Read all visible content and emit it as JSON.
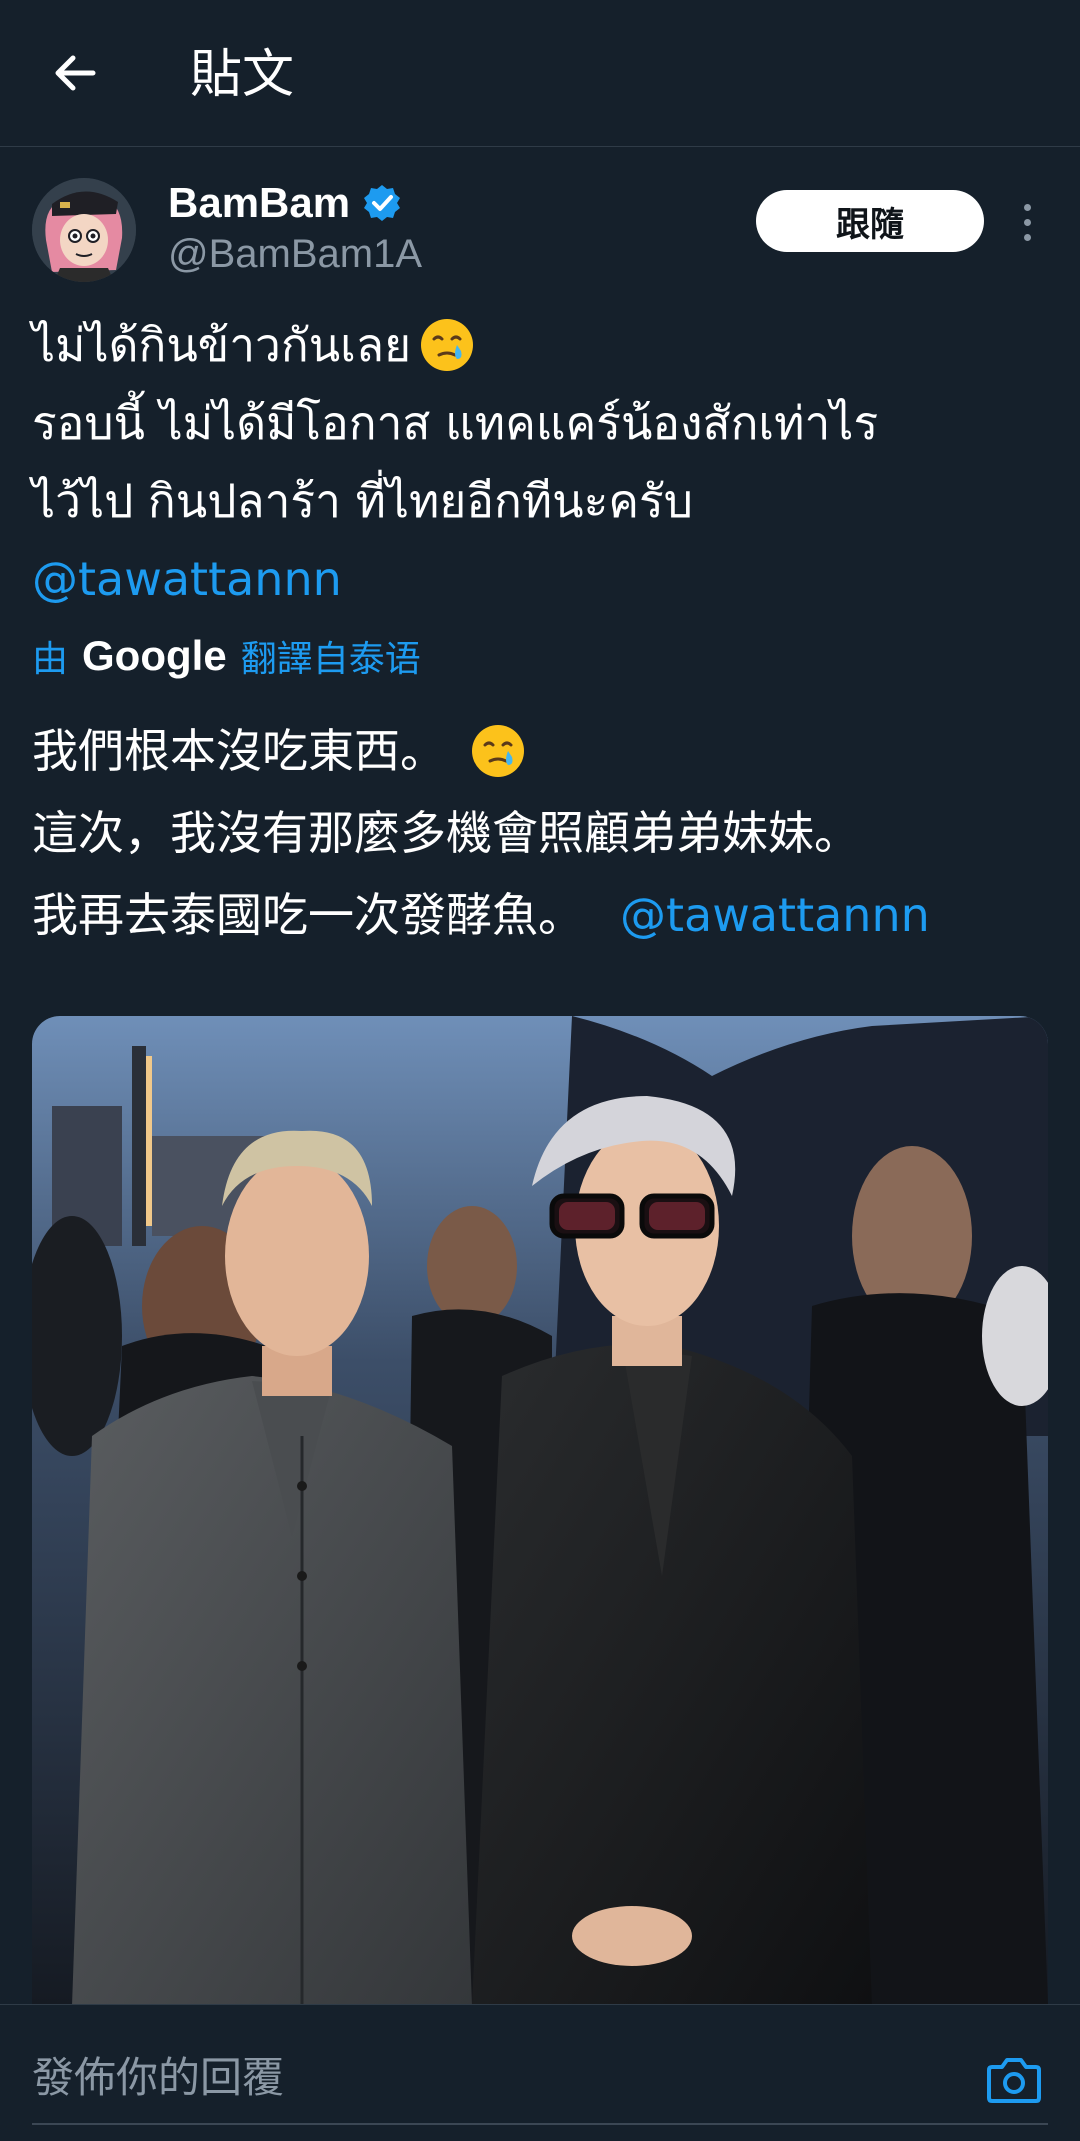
{
  "header": {
    "title": "貼文"
  },
  "post": {
    "display_name": "BamBam",
    "handle": "@BamBam1A",
    "follow_label": "跟隨",
    "original_lines": [
      "ไม่ได้กินข้าวกันเลย",
      "รอบนี้ ไม่ได้มีโอกาส แทคแคร์น้องสักเท่าไร",
      "ไว้ไป กินปลาร้า ที่ไทยอีกทีนะครับ"
    ],
    "original_mention": "@tawattannn",
    "translate_prefix": "由",
    "translate_brand": "Google",
    "translate_suffix": "翻譯自泰语",
    "translated_lines": [
      "我們根本沒吃東西。",
      "這次，我沒有那麼多機會照顧弟弟妹妹。",
      "我再去泰國吃一次發酵魚。"
    ],
    "translated_mention": "@tawattannn",
    "emoji": "face-holding-back-tears-emoji"
  },
  "reply": {
    "placeholder": "發佈你的回覆"
  },
  "colors": {
    "background": "#15202b",
    "accent": "#1d9bf0",
    "muted": "#8b98a5",
    "verified": "#1d9bf0"
  },
  "icons": {
    "back": "arrow-left-icon",
    "verified": "verified-badge-icon",
    "more": "more-vertical-icon",
    "camera": "camera-icon"
  }
}
